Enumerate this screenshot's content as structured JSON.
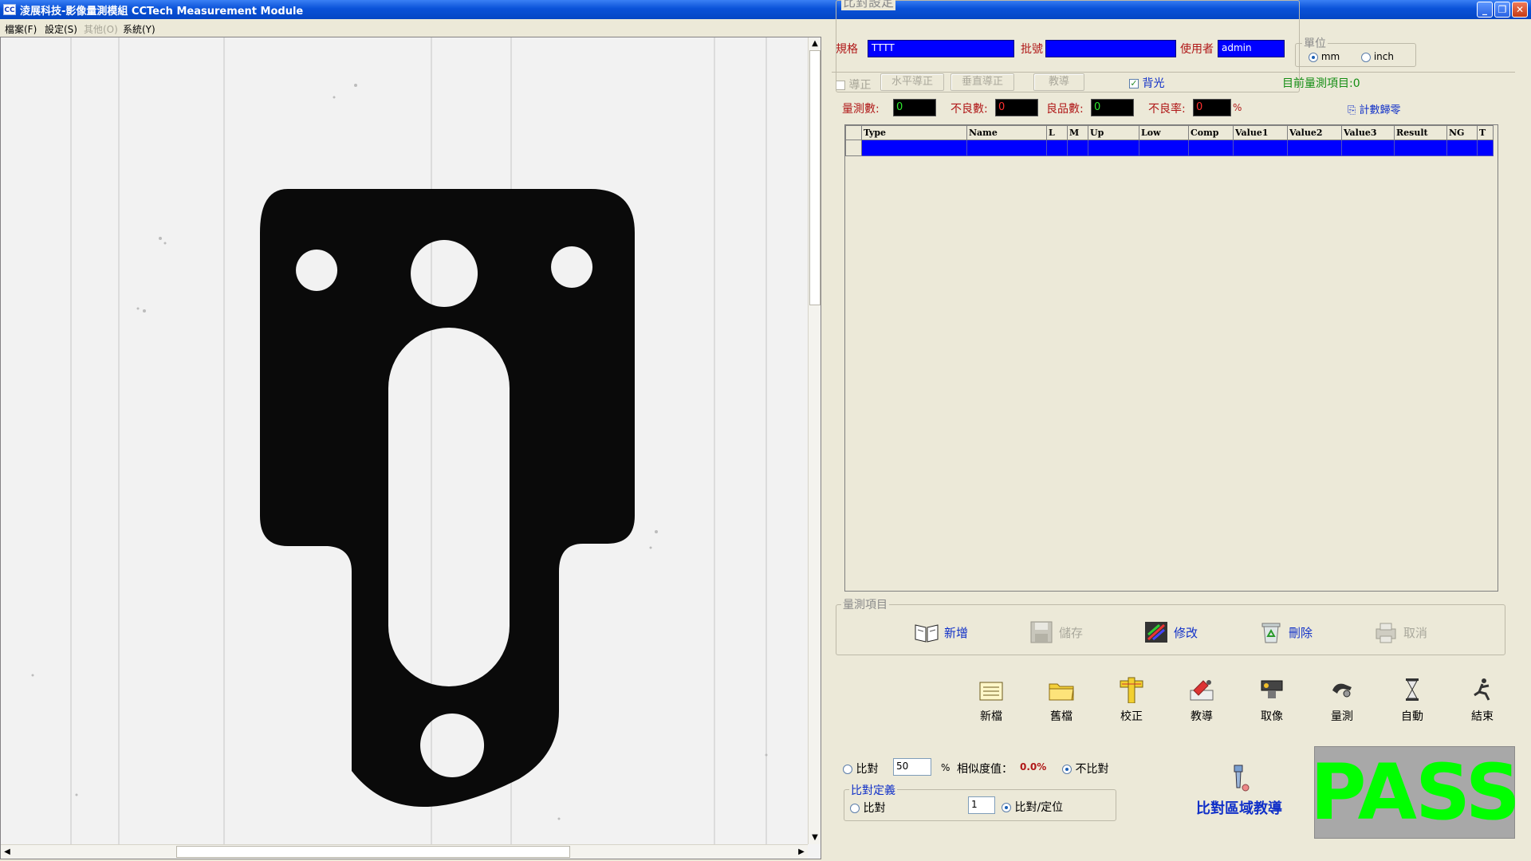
{
  "window": {
    "title": "淩展科技-影像量測模組 CCTech Measurement Module",
    "icon_label": "CC"
  },
  "menu": [
    {
      "label": "檔案(F)",
      "enabled": true
    },
    {
      "label": "設定(S)",
      "enabled": true
    },
    {
      "label": "其他(O)",
      "enabled": false
    },
    {
      "label": "系統(Y)",
      "enabled": true
    }
  ],
  "spec": {
    "label": "規格",
    "value": "TTTT"
  },
  "batch": {
    "label": "批號",
    "value": ""
  },
  "user": {
    "label": "使用者",
    "value": "admin"
  },
  "unit": {
    "title": "單位",
    "options": [
      "mm",
      "inch"
    ],
    "selected": "mm"
  },
  "align": {
    "checkbox_label": "導正",
    "horizontal_label": "水平導正",
    "vertical_label": "垂直導正",
    "teach_label": "教導"
  },
  "backlight": {
    "label": "背光",
    "checked": true
  },
  "current_items": "目前量測項目:0",
  "stats": {
    "measured_label": "量測數:",
    "measured": "0",
    "defect_label": "不良數:",
    "defect": "0",
    "good_label": "良品數:",
    "good": "0",
    "rate_label": "不良率:",
    "rate": "0",
    "percent": "%",
    "reset_label": "計數歸零"
  },
  "table": {
    "columns": [
      "Type",
      "Name",
      "L",
      "M",
      "Up",
      "Low",
      "Comp",
      "Value1",
      "Value2",
      "Value3",
      "Result",
      "NG",
      "T"
    ]
  },
  "measure_items": {
    "title": "量測項目",
    "buttons": [
      {
        "label": "新增",
        "icon": "book-icon",
        "enabled": true
      },
      {
        "label": "儲存",
        "icon": "floppy-icon",
        "enabled": false
      },
      {
        "label": "修改",
        "icon": "edit-icon",
        "enabled": true
      },
      {
        "label": "刪除",
        "icon": "recycle-icon",
        "enabled": true
      },
      {
        "label": "取消",
        "icon": "printer-icon",
        "enabled": false
      }
    ]
  },
  "toolbar": [
    {
      "label": "新檔",
      "icon": "new-file-icon"
    },
    {
      "label": "舊檔",
      "icon": "folder-icon"
    },
    {
      "label": "校正",
      "icon": "calibrate-icon"
    },
    {
      "label": "教導",
      "icon": "teach-icon"
    },
    {
      "label": "取像",
      "icon": "camera-icon"
    },
    {
      "label": "量測",
      "icon": "measure-icon"
    },
    {
      "label": "自動",
      "icon": "hourglass-icon"
    },
    {
      "label": "結束",
      "icon": "exit-icon"
    }
  ],
  "compare": {
    "title": "比對設定",
    "compare_label": "比對",
    "value": "50",
    "percent": "%",
    "similarity_label": "相似度值：",
    "similarity": "0.0%",
    "no_compare_label": "不比對",
    "selected": "no_compare"
  },
  "compare_def": {
    "title": "比對定義",
    "compare_label": "比對",
    "value": "1",
    "compare_locate_label": "比對/定位",
    "selected": "compare_locate"
  },
  "region_teach_label": "比對區域教導",
  "result": {
    "text": "PASS",
    "color": "#00ff00"
  }
}
